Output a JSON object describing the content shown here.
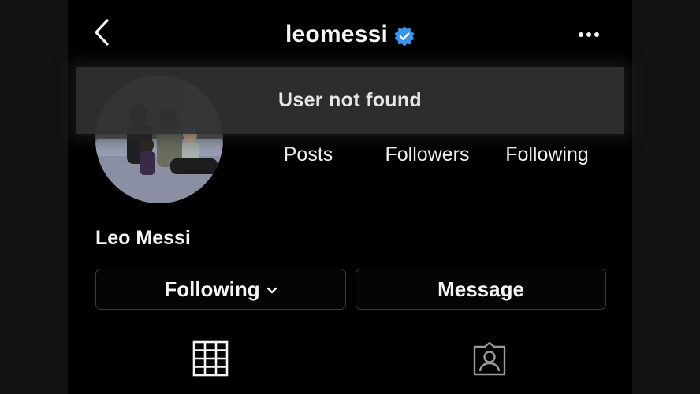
{
  "header": {
    "username": "leomessi",
    "back_icon": "chevron-left-icon",
    "verified_icon": "verified-badge-icon",
    "more_icon": "more-horizontal-icon"
  },
  "toast": {
    "message": "User not found"
  },
  "stats": [
    {
      "label": "Posts"
    },
    {
      "label": "Followers"
    },
    {
      "label": "Following"
    }
  ],
  "profile": {
    "full_name": "Leo Messi"
  },
  "buttons": {
    "following_label": "Following",
    "message_label": "Message"
  },
  "tabs": [
    {
      "icon": "grid-icon"
    },
    {
      "icon": "tagged-user-icon"
    }
  ],
  "colors": {
    "background": "#000000",
    "verified_blue": "#3897f0",
    "button_border": "#3b3b3b",
    "toast_bg": "#303030"
  }
}
